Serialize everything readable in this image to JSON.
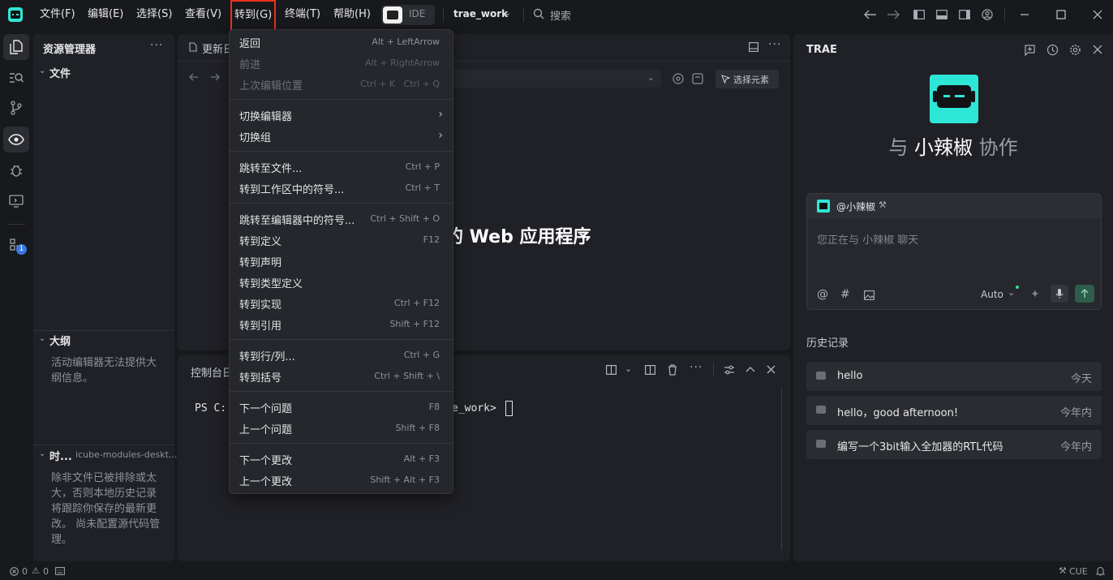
{
  "titlebar": {
    "menus": [
      "文件(F)",
      "编辑(E)",
      "选择(S)",
      "查看(V)",
      "转到(G)",
      "终端(T)",
      "帮助(H)"
    ],
    "ide_label": "IDE",
    "workspace": "trae_work",
    "search_placeholder": "搜索"
  },
  "sidebar": {
    "title": "资源管理器",
    "files_label": "文件",
    "outline_label": "大纲",
    "outline_msg": "活动编辑器无法提供大纲信息。",
    "timeline_label": "时...",
    "timeline_file": "icube-modules-deskt...",
    "timeline_msg": "除非文件已被排除或太大，否则本地历史记录将跟踪你保存的最新更改。 尚未配置源代码管理。"
  },
  "activity": {
    "badge": "1"
  },
  "editor": {
    "tab_label": "更新日",
    "select_element": "选择元素",
    "heading_tail": "的 Web 应用程序"
  },
  "panel": {
    "tab_label": "控制台日",
    "terminal_prefix": "PS C:",
    "terminal_suffix": "e_work> "
  },
  "goto_menu": {
    "items": [
      {
        "label": "返回",
        "shortcut": "Alt + LeftArrow",
        "disabled": false
      },
      {
        "label": "前进",
        "shortcut": "Alt + RightArrow",
        "disabled": true
      },
      {
        "label": "上次编辑位置",
        "shortcut": "Ctrl + K   Ctrl + Q",
        "disabled": true
      },
      {
        "label": "切换编辑器",
        "submenu": true
      },
      {
        "label": "切换组",
        "submenu": true
      },
      {
        "label": "跳转至文件...",
        "shortcut": "Ctrl + P"
      },
      {
        "label": "转到工作区中的符号...",
        "shortcut": "Ctrl + T"
      },
      {
        "label": "跳转至编辑器中的符号...",
        "shortcut": "Ctrl + Shift + O"
      },
      {
        "label": "转到定义",
        "shortcut": "F12"
      },
      {
        "label": "转到声明",
        "shortcut": ""
      },
      {
        "label": "转到类型定义",
        "shortcut": ""
      },
      {
        "label": "转到实现",
        "shortcut": "Ctrl + F12"
      },
      {
        "label": "转到引用",
        "shortcut": "Shift + F12"
      },
      {
        "label": "转到行/列...",
        "shortcut": "Ctrl + G"
      },
      {
        "label": "转到括号",
        "shortcut": "Ctrl + Shift + \\"
      },
      {
        "label": "下一个问题",
        "shortcut": "F8"
      },
      {
        "label": "上一个问题",
        "shortcut": "Shift + F8"
      },
      {
        "label": "下一个更改",
        "shortcut": "Alt + F3"
      },
      {
        "label": "上一个更改",
        "shortcut": "Shift + Alt + F3"
      }
    ]
  },
  "chat": {
    "title": "TRAE",
    "collab_prefix": "与",
    "agent_name": "小辣椒",
    "collab_suffix": "协作",
    "mention": "@小辣椒",
    "input_placeholder": "您正在与 小辣椒 聊天",
    "model": "Auto",
    "history_title": "历史记录",
    "history": [
      {
        "title": "hello",
        "time": "今天"
      },
      {
        "title": "hello，good afternoon!",
        "time": "今年内"
      },
      {
        "title": "编写一个3bit输入全加器的RTL代码",
        "time": "今年内"
      }
    ]
  },
  "status": {
    "errors": "0",
    "warnings": "0",
    "right_label": "CUE"
  },
  "colors": {
    "accent_teal": "#2ee6d6",
    "highlight_red": "#e8341c",
    "send_green": "#2e5d4b"
  }
}
